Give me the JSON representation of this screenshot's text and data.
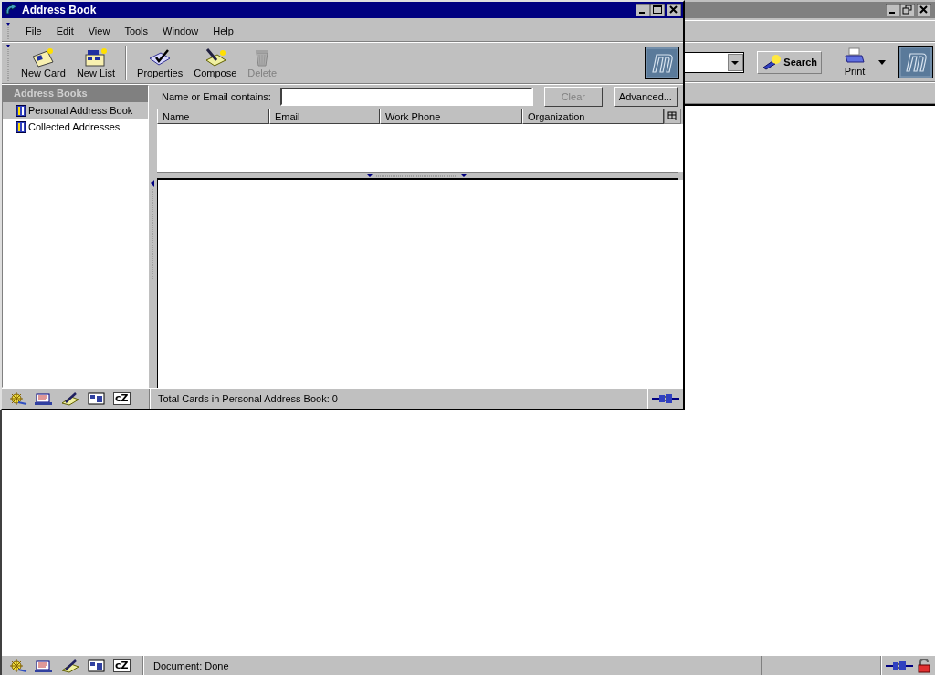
{
  "browser_window": {
    "search_button": "Search",
    "print_button": "Print",
    "component_bar": [
      {
        "kind": "navigator"
      },
      {
        "kind": "mail"
      },
      {
        "kind": "composer"
      },
      {
        "kind": "addressbook"
      },
      {
        "kind": "chat",
        "text": "cZ"
      }
    ],
    "status_bar": {
      "text": "Document: Done"
    }
  },
  "address_book": {
    "title": "Address Book",
    "menu": [
      {
        "label": "File"
      },
      {
        "label": "Edit"
      },
      {
        "label": "View"
      },
      {
        "label": "Tools"
      },
      {
        "label": "Window"
      },
      {
        "label": "Help"
      }
    ],
    "toolbar": [
      {
        "kind": "new-card",
        "label": "New Card",
        "disabled": false
      },
      {
        "kind": "new-list",
        "label": "New List",
        "disabled": false
      },
      {
        "kind": "separator"
      },
      {
        "kind": "properties",
        "label": "Properties",
        "disabled": false
      },
      {
        "kind": "compose",
        "label": "Compose",
        "disabled": false
      },
      {
        "kind": "delete",
        "label": "Delete",
        "disabled": true
      }
    ],
    "sidebar": {
      "header": "Address Books",
      "items": [
        {
          "label": "Personal Address Book",
          "selected": true
        },
        {
          "label": "Collected Addresses",
          "selected": false
        }
      ]
    },
    "search": {
      "label": "Name or Email contains:",
      "buttons": [
        {
          "label": "Clear",
          "disabled": true
        },
        {
          "label": "Advanced...",
          "disabled": false
        }
      ]
    },
    "table": {
      "columns": [
        "Name",
        "Email",
        "Work Phone",
        "Organization"
      ]
    },
    "component_bar": [
      {
        "kind": "navigator"
      },
      {
        "kind": "mail"
      },
      {
        "kind": "composer"
      },
      {
        "kind": "addressbook"
      },
      {
        "kind": "chat",
        "text": "cZ"
      }
    ],
    "status_bar": {
      "text": "Total Cards in Personal Address Book: 0"
    }
  }
}
